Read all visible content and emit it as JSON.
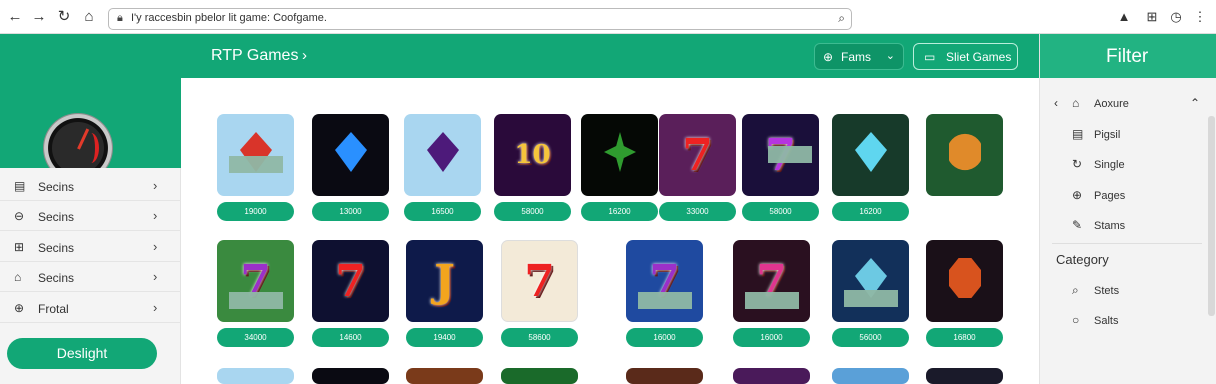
{
  "browser": {
    "url": "I'y raccesbin pbelor lit game: Coofgame."
  },
  "header": {
    "title": "RTP Games",
    "farms_label": "Fams",
    "slot_games_label": "Sliet Games"
  },
  "filter": {
    "title": "Filter",
    "items": [
      {
        "label": "Aoxure"
      },
      {
        "label": "Pigsil"
      },
      {
        "label": "Single"
      },
      {
        "label": "Pages"
      },
      {
        "label": "Stams"
      }
    ],
    "category_label": "Category",
    "category_items": [
      {
        "label": "Stets"
      },
      {
        "label": "Salts"
      }
    ]
  },
  "sidebar": {
    "items": [
      {
        "label": "Secins",
        "icon": "list-icon"
      },
      {
        "label": "Secins",
        "icon": "chat-icon"
      },
      {
        "label": "Secins",
        "icon": "grid-icon"
      },
      {
        "label": "Secins",
        "icon": "bag-icon"
      },
      {
        "label": "Frotal",
        "icon": "globe-icon"
      }
    ],
    "cta_label": "Deslight"
  },
  "games_row1": [
    {
      "rtp": "19000",
      "art": "red-gem"
    },
    {
      "rtp": "13000",
      "art": "blue-gem"
    },
    {
      "rtp": "16500",
      "art": "purple-gem"
    },
    {
      "rtp": "58000",
      "art": "phenic-logo"
    },
    {
      "rtp": "16200",
      "art": "green-flower"
    },
    {
      "rtp": "33000",
      "art": "wild-seven"
    },
    {
      "rtp": "58000",
      "art": "purple-seven"
    },
    {
      "rtp": "16200",
      "art": "cyan-diamond"
    },
    {
      "art": "lion"
    }
  ],
  "games_row2": [
    {
      "rtp": "34000",
      "art": "purple-seven"
    },
    {
      "rtp": "14600",
      "art": "red-seven"
    },
    {
      "rtp": "19400",
      "art": "gold-j"
    },
    {
      "rtp": "58600",
      "art": "framed-seven"
    },
    {
      "rtp": "16000",
      "art": "purple-seven-blue"
    },
    {
      "rtp": "16000",
      "art": "pink-seven"
    },
    {
      "rtp": "56000",
      "art": "cyan-diamond"
    },
    {
      "rtp": "16800",
      "art": "orange-gem"
    }
  ],
  "colors": {
    "brand_green": "#12a776",
    "dark_green": "#0e9467"
  }
}
